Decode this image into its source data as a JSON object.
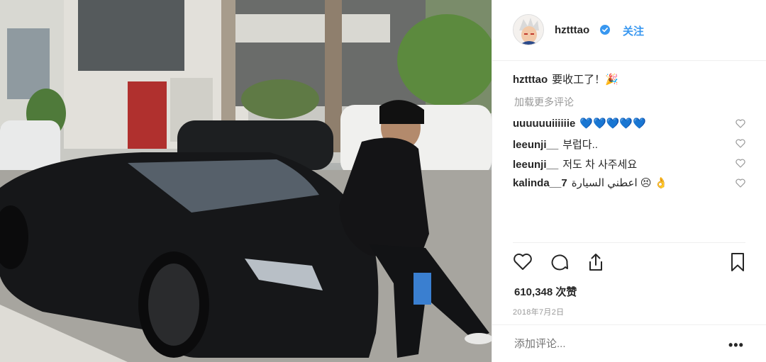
{
  "post": {
    "photo_alt": "man sitting on a black sports car",
    "username": "hztttao",
    "follow_label": "关注",
    "caption": {
      "username": "hztttao",
      "text": "要收工了！🎉"
    },
    "load_more_label": "加载更多评论",
    "comments": [
      {
        "username": "uuuuuuiiiiiie",
        "text": "💙💙💙💙💙"
      },
      {
        "username": "leeunji__",
        "text": "부럽다.."
      },
      {
        "username": "leeunji__",
        "text": "저도 차 사주세요"
      },
      {
        "username": "kalinda__7",
        "text": "اعطني السيارة 😣 👌"
      }
    ],
    "likes_text": "610,348 次赞",
    "date": "2018年7月2日",
    "add_comment_placeholder": "添加评论...",
    "more_label": "•••"
  },
  "colors": {
    "accent": "#3897f0",
    "text": "#262626",
    "muted": "#999999",
    "border": "#efefef"
  },
  "icons": {
    "verified": "verified-badge-icon",
    "like": "heart-icon",
    "comment": "comment-icon",
    "share": "share-icon",
    "save": "bookmark-icon",
    "comment_like": "heart-small-icon",
    "options": "more-options-icon"
  }
}
